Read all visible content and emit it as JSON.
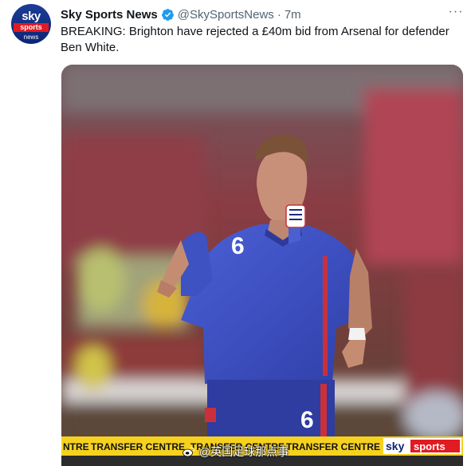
{
  "tweet": {
    "author_name": "Sky Sports News",
    "handle": "@SkySportsNews",
    "separator": "·",
    "time": "7m",
    "more_label": "···",
    "text": "BREAKING: Brighton have rejected a £40m bid from Arsenal for defender Ben White."
  },
  "avatar": {
    "line1": "sky",
    "line2": "sports",
    "line3": "news"
  },
  "media": {
    "shirt_number": "6",
    "ticker_items": [
      "NTRE",
      "TRANSFER CENTRE",
      "TRANSFER CENTRE",
      "TRANSFER CENTRE"
    ],
    "ticker_logo_sky": "sky",
    "ticker_logo_sports": "sports"
  },
  "watermark": {
    "text": "@英国足球那点事"
  },
  "colors": {
    "verified_blue": "#1d9bf0",
    "ticker_yellow": "#f6d21f",
    "kit_blue": "#3b4fc4",
    "sky_red": "#e11b22"
  },
  "icons": [
    "verified-badge-icon",
    "more-options-icon",
    "weibo-icon"
  ]
}
